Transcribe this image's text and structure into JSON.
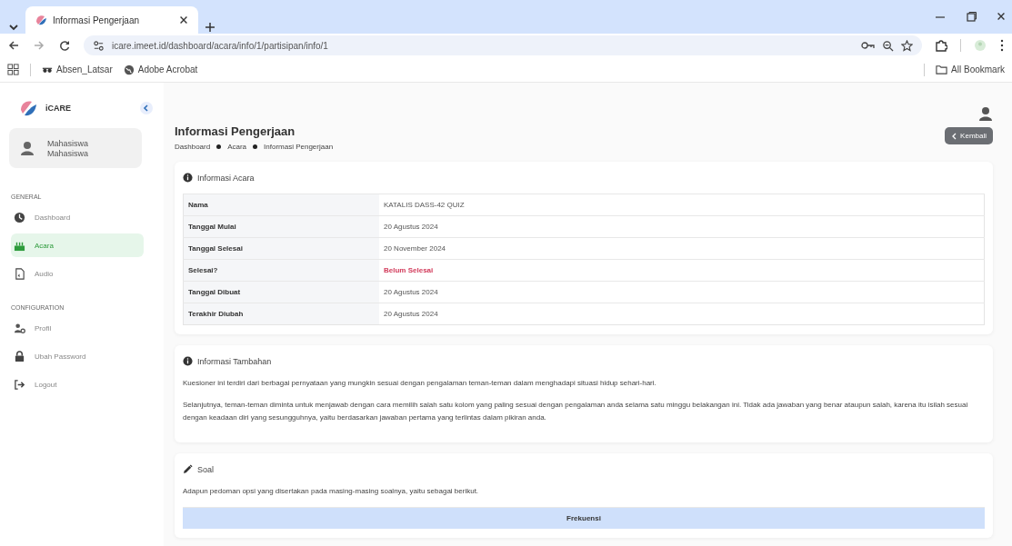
{
  "browser": {
    "tab_title": "Informasi Pengerjaan",
    "url": "icare.imeet.id/dashboard/acara/info/1/partisipan/info/1",
    "bookmarks": [
      "Absen_Latsar",
      "Adobe Acrobat"
    ],
    "all_bookmarks": "All Bookmark"
  },
  "sidebar": {
    "brand": "iCARE",
    "user": {
      "name": "Mahasiswa",
      "role": "Mahasiswa"
    },
    "sections": [
      {
        "title": "GENERAL",
        "items": [
          {
            "label": "Dashboard",
            "selected": false
          },
          {
            "label": "Acara",
            "selected": true
          },
          {
            "label": "Audio",
            "selected": false
          }
        ]
      },
      {
        "title": "CONFIGURATION",
        "items": [
          {
            "label": "Profil",
            "selected": false
          },
          {
            "label": "Ubah Password",
            "selected": false
          },
          {
            "label": "Logout",
            "selected": false
          }
        ]
      }
    ]
  },
  "page": {
    "title": "Informasi Pengerjaan",
    "breadcrumb": [
      "Dashboard",
      "Acara",
      "Informasi Pengerjaan"
    ],
    "back_button": "Kembali"
  },
  "event_info": {
    "title": "Informasi Acara",
    "rows": [
      {
        "label": "Nama",
        "value": "KATALIS DASS-42 QUIZ"
      },
      {
        "label": "Tanggal Mulai",
        "value": "20 Agustus 2024"
      },
      {
        "label": "Tanggal Selesai",
        "value": "20 November 2024"
      },
      {
        "label": "Selesai?",
        "value": "Belum Selesai",
        "done": false
      },
      {
        "label": "Tanggal Dibuat",
        "value": "20 Agustus 2024"
      },
      {
        "label": "Terakhir Diubah",
        "value": "20 Agustus 2024"
      }
    ]
  },
  "additional_info": {
    "title": "Informasi Tambahan",
    "paragraphs": [
      "Kuesioner ini terdiri dari berbagai pernyataan yang mungkin sesuai dengan pengalaman teman-teman dalam menghadapi situasi hidup sehari-hari.",
      "Selanjutnya, teman-teman diminta untuk menjawab dengan cara memilih salah satu kolom yang paling sesuai dengan pengalaman anda selama satu minggu belakangan ini. Tidak ada jawaban yang benar ataupun salah, karena itu isilah sesuai dengan keadaan diri yang sesungguhnya, yaitu berdasarkan jawaban pertama yang terlintas dalam pikiran anda."
    ]
  },
  "questions": {
    "title": "Soal",
    "intro": "Adapun pedoman opsi yang disertakan pada masing-masing soalnya, yaitu sebagai berikut.",
    "table": {
      "columns": [
        "Frekuensi"
      ]
    }
  }
}
